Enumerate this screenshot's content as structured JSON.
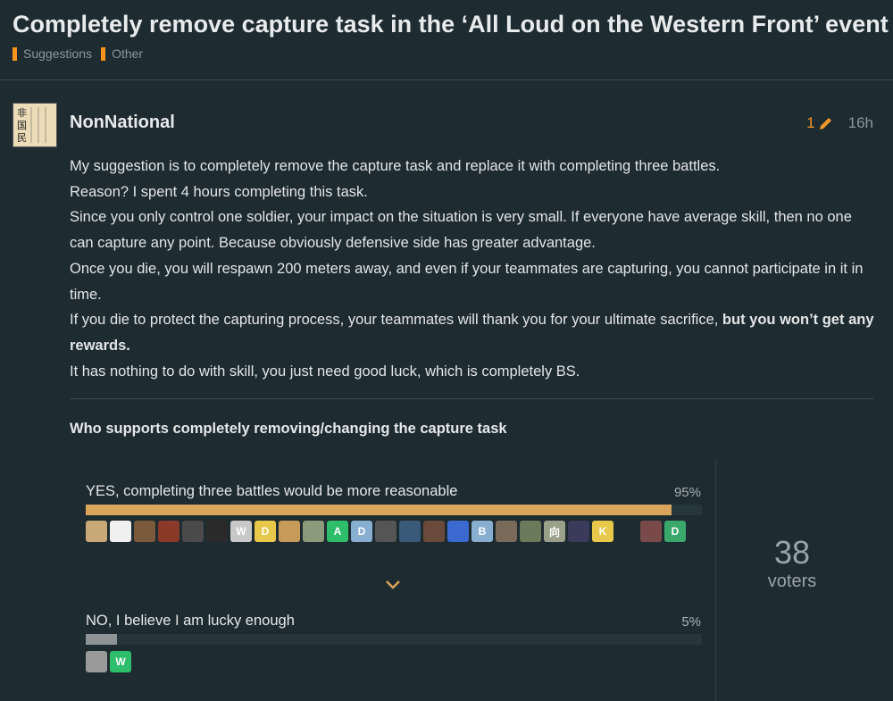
{
  "topic": {
    "title": "Completely remove capture task in the ‘All Loud on the Western Front’ event",
    "categories": [
      "Suggestions",
      "Other"
    ],
    "category_color": "#f7941d"
  },
  "post": {
    "username": "NonNational",
    "edit_count": "1",
    "age": "16h",
    "avatar_text": "非国民",
    "paragraphs": [
      "My suggestion is to completely remove the capture task and replace it with completing three battles.",
      "Reason? I spent 4 hours completing this task.",
      "Since you only control one soldier, your impact on the situation is very small. If everyone have average skill, then no one can capture any point. Because obviously defensive side has greater advantage.",
      "Once you die, you will respawn 200 meters away, and even if your teammates are capturing, you cannot participate in it in time."
    ],
    "p5_text": "If you die to protect the capturing process, your teammates will thank you for your ultimate sacrifice, ",
    "p5_bold": "but you won’t get any rewards.",
    "p6": "It has nothing to do with skill, you just need good luck, which is completely BS."
  },
  "poll": {
    "title": "Who supports completely removing/changing the capture task",
    "options": [
      {
        "label": "YES, completing three battles would be more reasonable",
        "percent_text": "95%",
        "percent": 95,
        "color": "#d9a45b"
      },
      {
        "label": "NO, I believe I am lucky enough",
        "percent_text": "5%",
        "percent": 5,
        "color": "#8e9396"
      }
    ],
    "yes_voters": [
      {
        "letter": "",
        "color": "#c9a877"
      },
      {
        "letter": "",
        "color": "#f0f0f0"
      },
      {
        "letter": "",
        "color": "#7a5a3a"
      },
      {
        "letter": "",
        "color": "#8b3a2a"
      },
      {
        "letter": "",
        "color": "#4a4a4a"
      },
      {
        "letter": "",
        "color": "#2a2a2a"
      },
      {
        "letter": "W",
        "color": "#c8c8c8"
      },
      {
        "letter": "D",
        "color": "#e8c84a"
      },
      {
        "letter": "",
        "color": "#c89a5a"
      },
      {
        "letter": "",
        "color": "#8a9a7a"
      },
      {
        "letter": "A",
        "color": "#2ebd6b"
      },
      {
        "letter": "D",
        "color": "#88aed0"
      },
      {
        "letter": "",
        "color": "#555555"
      },
      {
        "letter": "",
        "color": "#3a5a7a"
      },
      {
        "letter": "",
        "color": "#6a4a3a"
      },
      {
        "letter": "",
        "color": "#3a6ad0"
      },
      {
        "letter": "B",
        "color": "#88aed0"
      },
      {
        "letter": "",
        "color": "#7a6a5a"
      },
      {
        "letter": "",
        "color": "#6a7a5a"
      },
      {
        "letter": "向",
        "color": "#9aa08a"
      },
      {
        "letter": "",
        "color": "#3a3a5a"
      },
      {
        "letter": "K",
        "color": "#e8c84a"
      },
      {
        "letter": "",
        "color": "#1e2b30"
      },
      {
        "letter": "",
        "color": "#7a4a4a"
      },
      {
        "letter": "D",
        "color": "#3aa86b"
      }
    ],
    "no_voters": [
      {
        "letter": "",
        "color": "#9a9a9a"
      },
      {
        "letter": "W",
        "color": "#2ebd6b"
      }
    ],
    "voters_count": "38",
    "voters_label": "voters"
  }
}
